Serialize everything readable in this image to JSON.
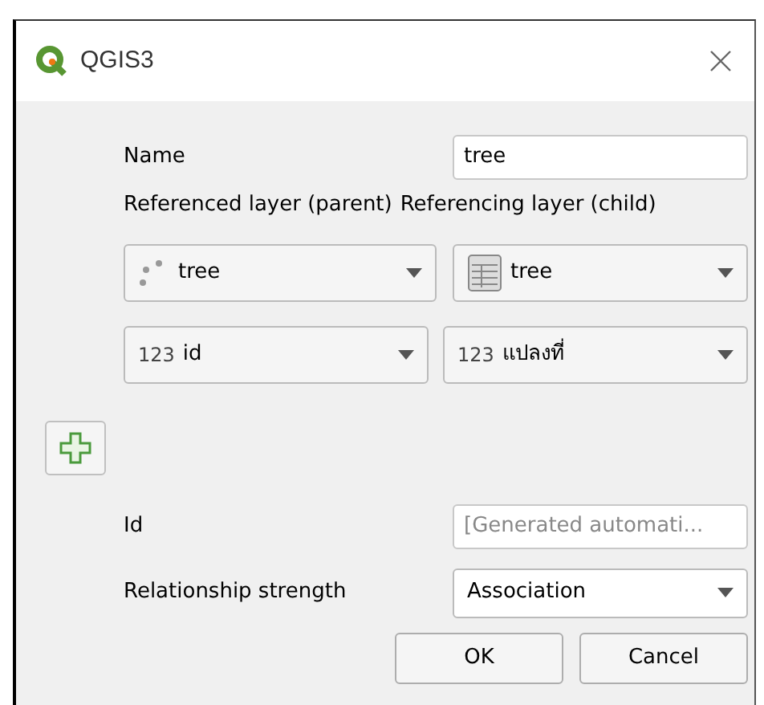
{
  "window": {
    "title": "QGIS3"
  },
  "name": {
    "label": "Name",
    "value": "tree"
  },
  "layer_headers": [
    "Referenced layer (parent)",
    "Referencing layer (child)"
  ],
  "layer_combos": [
    {
      "kind": "point",
      "value": "tree"
    },
    {
      "kind": "table",
      "value": "tree"
    }
  ],
  "field_combos": [
    {
      "type_label": "123",
      "value": "id"
    },
    {
      "type_label": "123",
      "value": "แปลงที่"
    }
  ],
  "id": {
    "label": "Id",
    "placeholder": "[Generated automati..."
  },
  "strength": {
    "label": "Relationship strength",
    "value": "Association"
  },
  "buttons": [
    "OK",
    "Cancel"
  ]
}
